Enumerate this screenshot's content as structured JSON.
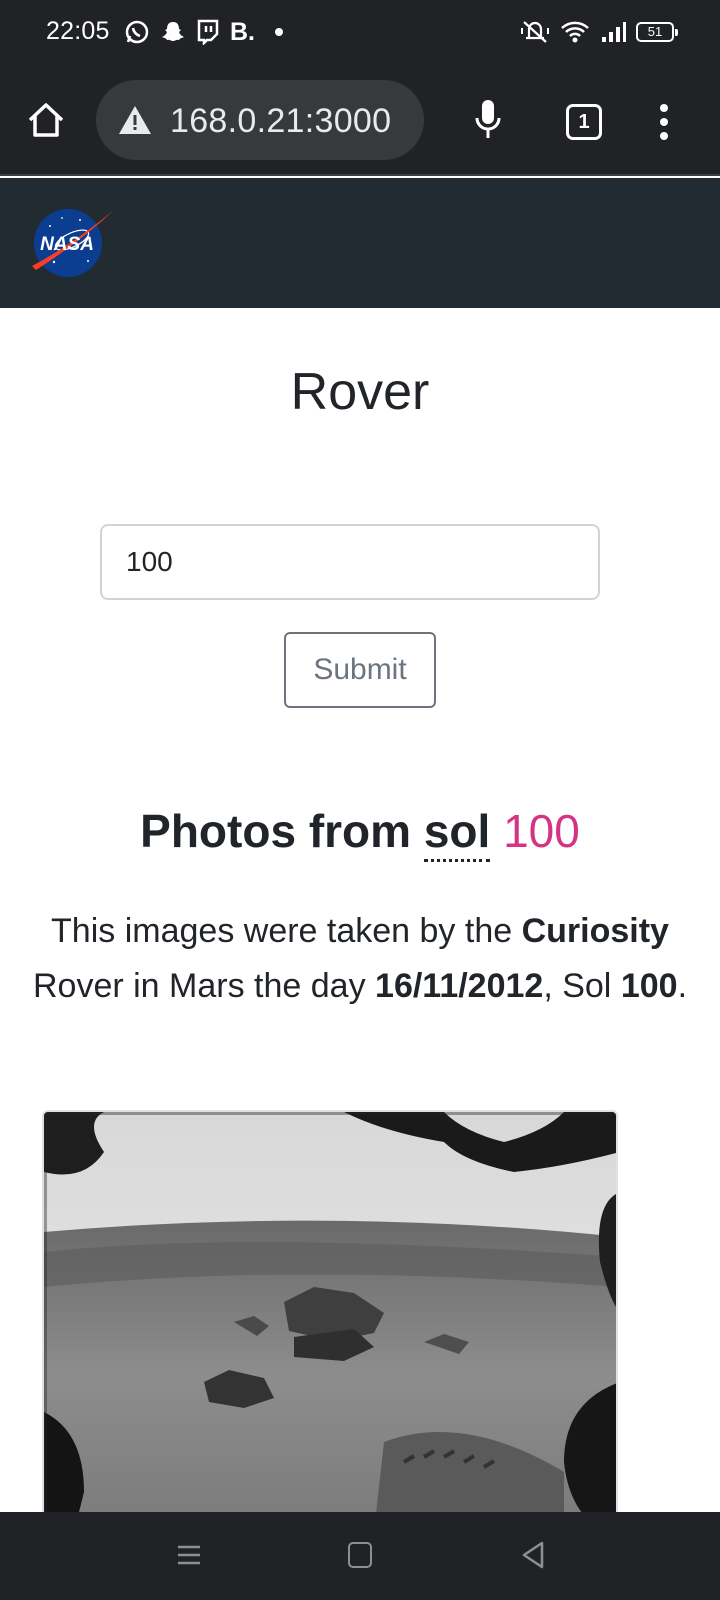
{
  "status_bar": {
    "time": "22:05",
    "app_b": "B.",
    "battery": "51"
  },
  "browser": {
    "url": "168.0.21:3000",
    "tab_count": "1"
  },
  "page": {
    "title": "Rover",
    "input_value": "100",
    "submit_label": "Submit",
    "photos_heading_prefix": "Photos from",
    "photos_heading_sol": "sol",
    "photos_heading_number": "100",
    "description": {
      "part1": "This images were taken by the",
      "rover": "Curiosity",
      "part2": "Rover in Mars the day",
      "date": "16/11/2012",
      "part3": ", Sol",
      "sol": "100",
      "part4": "."
    }
  },
  "icons": [
    "home-icon",
    "warning-icon",
    "mic-icon",
    "tabs-icon",
    "more-vert-icon",
    "nasa-logo",
    "menu-icon",
    "square-icon",
    "back-icon"
  ],
  "colors": {
    "sol_number": "#d63384",
    "navbar": "#222a32"
  }
}
